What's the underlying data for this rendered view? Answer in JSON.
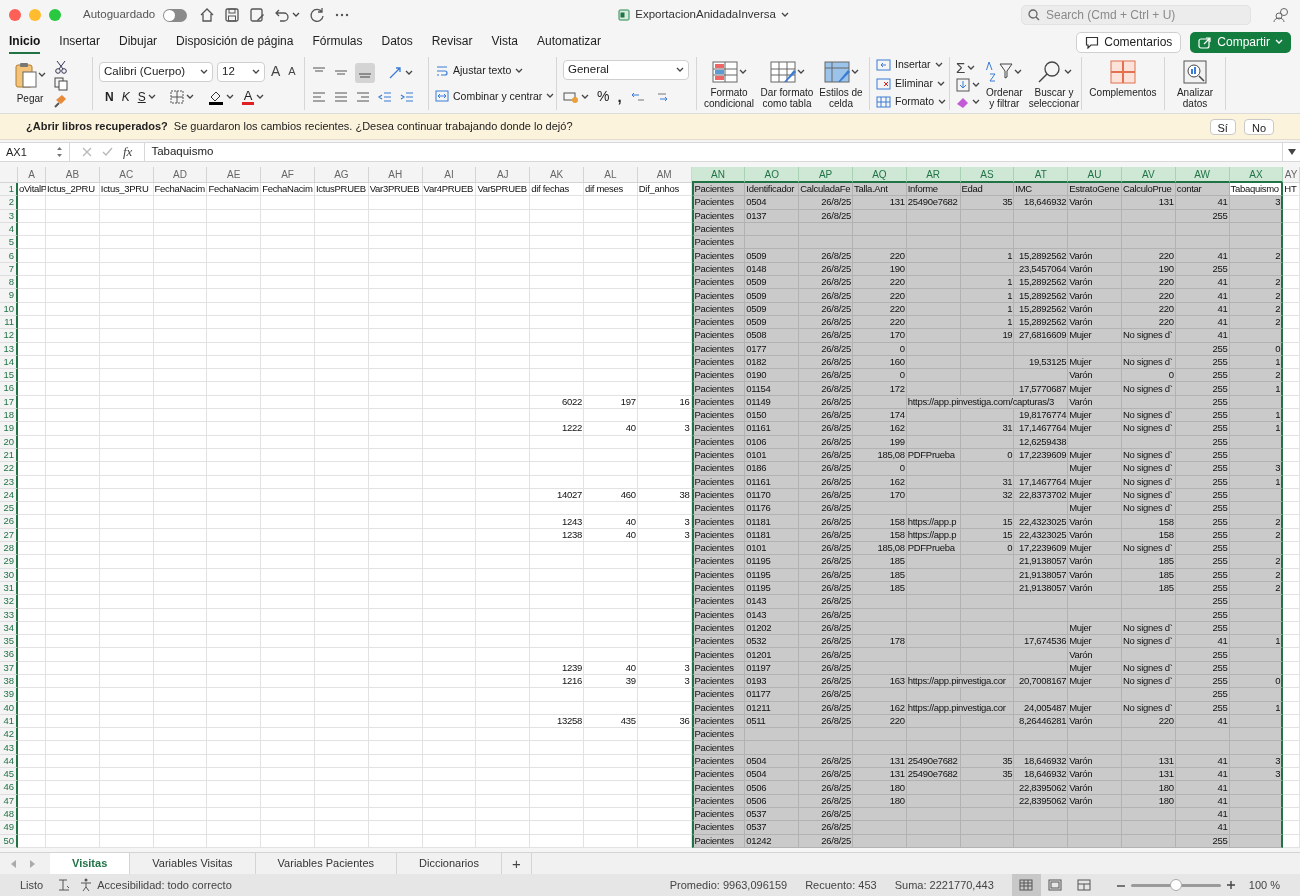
{
  "window": {
    "title": "ExportacionAnidadaInversa",
    "autosave_label": "Autoguardado",
    "autosave_on": false,
    "search_placeholder": "Search (Cmd + Ctrl + U)"
  },
  "menu_tabs": [
    {
      "label": "Inicio",
      "selected": true
    },
    {
      "label": "Insertar",
      "selected": false
    },
    {
      "label": "Dibujar",
      "selected": false
    },
    {
      "label": "Disposición de página",
      "selected": false
    },
    {
      "label": "Fórmulas",
      "selected": false
    },
    {
      "label": "Datos",
      "selected": false
    },
    {
      "label": "Revisar",
      "selected": false
    },
    {
      "label": "Vista",
      "selected": false
    },
    {
      "label": "Automatizar",
      "selected": false
    }
  ],
  "actions": {
    "comments": "Comentarios",
    "share": "Compartir"
  },
  "ribbon": {
    "paste": "Pegar",
    "font": "Calibri (Cuerpo)",
    "size": "12",
    "grow": "A",
    "shrink": "A",
    "bold": "N",
    "italic": "K",
    "underline": "S",
    "font_color": "A",
    "wrap": "Ajustar texto",
    "merge": "Combinar y centrar",
    "number_format": "General",
    "percent": "%",
    "comma": ",",
    "styles": [
      {
        "kind": "conditional",
        "label": "Formato condicional"
      },
      {
        "kind": "table",
        "label": "Dar formato como tabla"
      },
      {
        "kind": "cellstyle",
        "label": "Estilos de celda"
      }
    ],
    "cells": [
      {
        "kind": "insert",
        "label": "Insertar"
      },
      {
        "kind": "delete",
        "label": "Eliminar"
      },
      {
        "kind": "format",
        "label": "Formato"
      }
    ],
    "sum": "Σ",
    "editing": [
      {
        "kind": "sort",
        "label": "Ordenar y filtrar"
      },
      {
        "kind": "find",
        "label": "Buscar y seleccionar"
      },
      {
        "kind": "addins",
        "label": "Complementos"
      },
      {
        "kind": "analyze",
        "label": "Analizar datos"
      }
    ]
  },
  "message_bar": {
    "title": "¿Abrir libros recuperados?",
    "text": "Se guardaron los cambios recientes. ¿Desea continuar trabajando donde lo dejó?",
    "buttons": [
      "Sí",
      "No"
    ]
  },
  "formula_bar": {
    "name_box": "AX1",
    "fx": "fx",
    "formula": "Tabaquismo"
  },
  "grid": {
    "columns": [
      {
        "letter": "A",
        "selected": false
      },
      {
        "letter": "AB",
        "selected": false
      },
      {
        "letter": "AC",
        "selected": false
      },
      {
        "letter": "AD",
        "selected": false
      },
      {
        "letter": "AE",
        "selected": false
      },
      {
        "letter": "AF",
        "selected": false
      },
      {
        "letter": "AG",
        "selected": false
      },
      {
        "letter": "AH",
        "selected": false
      },
      {
        "letter": "AI",
        "selected": false
      },
      {
        "letter": "AJ",
        "selected": false
      },
      {
        "letter": "AK",
        "selected": false
      },
      {
        "letter": "AL",
        "selected": false
      },
      {
        "letter": "AM",
        "selected": false
      },
      {
        "letter": "AN",
        "selected": true
      },
      {
        "letter": "AO",
        "selected": true
      },
      {
        "letter": "AP",
        "selected": true
      },
      {
        "letter": "AQ",
        "selected": true
      },
      {
        "letter": "AR",
        "selected": true
      },
      {
        "letter": "AS",
        "selected": true
      },
      {
        "letter": "AT",
        "selected": true
      },
      {
        "letter": "AU",
        "selected": true
      },
      {
        "letter": "AV",
        "selected": true
      },
      {
        "letter": "AW",
        "selected": true
      },
      {
        "letter": "AX",
        "selected": true
      },
      {
        "letter": "AY",
        "selected": false
      }
    ],
    "rows": [
      {
        "number": "1",
        "selected": true,
        "cells": {
          "A": "oVitalP",
          "AB": "Ictus_2PRU",
          "AC": "Ictus_3PRU",
          "AD": "FechaNacim",
          "AE": "FechaNacim",
          "AF": "FechaNacim",
          "AG": "IctusPRUEB",
          "AH": "Var3PRUEB",
          "AI": "Var4PRUEB",
          "AJ": "Var5PRUEB",
          "AK": "dif fechas",
          "AL": "dif meses",
          "AM": "Dif_anhos",
          "AN": "Pacientes",
          "AO": "Identificador",
          "AP": "CalculadaFe",
          "AQ": "Talla.Ant",
          "AR": "Informe",
          "AS": "Edad",
          "AT": "IMC",
          "AU": "EstratoGene",
          "AV": "CalculoPrue",
          "AW": "contar",
          "AX": {
            "text": "Tabaquismo",
            "active": true
          },
          "AY": "HT"
        }
      },
      {
        "number": "2",
        "selected": true,
        "cells": {
          "AN": "Pacientes",
          "AO": "0504",
          "AP": "26/8/25",
          "AQ": "131",
          "AR": "25490e7682",
          "AS": "35",
          "AT": "18,646932",
          "AU": "Varón",
          "AV": "131",
          "AW": "41",
          "AX": "3"
        }
      },
      {
        "number": "3",
        "selected": true,
        "cells": {
          "AN": "Pacientes",
          "AO": "0137",
          "AP": "26/8/25",
          "AW": "255"
        }
      },
      {
        "number": "4",
        "selected": true,
        "cells": {
          "AN": "Pacientes"
        }
      },
      {
        "number": "5",
        "selected": true,
        "cells": {
          "AN": "Pacientes"
        }
      },
      {
        "number": "6",
        "selected": true,
        "cells": {
          "AN": "Pacientes",
          "AO": "0509",
          "AP": "26/8/25",
          "AQ": "220",
          "AS": "1",
          "AT": "15,2892562",
          "AU": "Varón",
          "AV": "220",
          "AW": "41",
          "AX": "2"
        }
      },
      {
        "number": "7",
        "selected": true,
        "cells": {
          "AN": "Pacientes",
          "AO": "0148",
          "AP": "26/8/25",
          "AQ": "190",
          "AT": "23,5457064",
          "AU": "Varón",
          "AV": "190",
          "AW": "255"
        }
      },
      {
        "number": "8",
        "selected": true,
        "cells": {
          "AN": "Pacientes",
          "AO": "0509",
          "AP": "26/8/25",
          "AQ": "220",
          "AS": "1",
          "AT": "15,2892562",
          "AU": "Varón",
          "AV": "220",
          "AW": "41",
          "AX": "2"
        }
      },
      {
        "number": "9",
        "selected": true,
        "cells": {
          "AN": "Pacientes",
          "AO": "0509",
          "AP": "26/8/25",
          "AQ": "220",
          "AS": "1",
          "AT": "15,2892562",
          "AU": "Varón",
          "AV": "220",
          "AW": "41",
          "AX": "2"
        }
      },
      {
        "number": "10",
        "selected": true,
        "cells": {
          "AN": "Pacientes",
          "AO": "0509",
          "AP": "26/8/25",
          "AQ": "220",
          "AS": "1",
          "AT": "15,2892562",
          "AU": "Varón",
          "AV": "220",
          "AW": "41",
          "AX": "2"
        }
      },
      {
        "number": "11",
        "selected": true,
        "cells": {
          "AN": "Pacientes",
          "AO": "0509",
          "AP": "26/8/25",
          "AQ": "220",
          "AS": "1",
          "AT": "15,2892562",
          "AU": "Varón",
          "AV": "220",
          "AW": "41",
          "AX": "2"
        }
      },
      {
        "number": "12",
        "selected": true,
        "cells": {
          "AN": "Pacientes",
          "AO": "0508",
          "AP": "26/8/25",
          "AQ": "170",
          "AS": "19",
          "AT": "27,6816609",
          "AU": "Mujer",
          "AV": "No signes d`",
          "AW": "41"
        }
      },
      {
        "number": "13",
        "selected": true,
        "cells": {
          "AN": "Pacientes",
          "AO": "0177",
          "AP": "26/8/25",
          "AQ": "0",
          "AW": "255",
          "AX": "0"
        }
      },
      {
        "number": "14",
        "selected": true,
        "cells": {
          "AN": "Pacientes",
          "AO": "0182",
          "AP": "26/8/25",
          "AQ": "160",
          "AT": "19,53125",
          "AU": "Mujer",
          "AV": "No signes d`",
          "AW": "255",
          "AX": "1"
        }
      },
      {
        "number": "15",
        "selected": true,
        "cells": {
          "AN": "Pacientes",
          "AO": "0190",
          "AP": "26/8/25",
          "AQ": "0",
          "AU": "Varón",
          "AV": "0",
          "AW": "255",
          "AX": "2"
        }
      },
      {
        "number": "16",
        "selected": true,
        "cells": {
          "AN": "Pacientes",
          "AO": "01154",
          "AP": "26/8/25",
          "AQ": "172",
          "AT": "17,5770687",
          "AU": "Mujer",
          "AV": "No signes d`",
          "AW": "255",
          "AX": "1"
        }
      },
      {
        "number": "17",
        "selected": true,
        "cells": {
          "AK": "6022",
          "AL": "197",
          "AM": "16",
          "AN": "Pacientes",
          "AO": "01149",
          "AP": "26/8/25",
          "AR": "https://app.pinvestiga.com/capturas/3",
          "AU": "Varón",
          "AW": "255"
        }
      },
      {
        "number": "18",
        "selected": true,
        "cells": {
          "AN": "Pacientes",
          "AO": "0150",
          "AP": "26/8/25",
          "AQ": "174",
          "AT": "19,8176774",
          "AU": "Mujer",
          "AV": "No signes d`",
          "AW": "255",
          "AX": "1"
        }
      },
      {
        "number": "19",
        "selected": true,
        "cells": {
          "AK": "1222",
          "AL": "40",
          "AM": "3",
          "AN": "Pacientes",
          "AO": "01161",
          "AP": "26/8/25",
          "AQ": "162",
          "AS": "31",
          "AT": "17,1467764",
          "AU": "Mujer",
          "AV": "No signes d`",
          "AW": "255",
          "AX": "1"
        }
      },
      {
        "number": "20",
        "selected": true,
        "cells": {
          "AN": "Pacientes",
          "AO": "0106",
          "AP": "26/8/25",
          "AQ": "199",
          "AT": "12,6259438",
          "AW": "255"
        }
      },
      {
        "number": "21",
        "selected": true,
        "cells": {
          "AN": "Pacientes",
          "AO": "0101",
          "AP": "26/8/25",
          "AQ": "185,08",
          "AR": "PDFPrueba",
          "AS": "0",
          "AT": "17,2239609",
          "AU": "Mujer",
          "AV": "No signes d`",
          "AW": "255"
        }
      },
      {
        "number": "22",
        "selected": true,
        "cells": {
          "AN": "Pacientes",
          "AO": "0186",
          "AP": "26/8/25",
          "AQ": "0",
          "AU": "Mujer",
          "AV": "No signes d`",
          "AW": "255",
          "AX": "3"
        }
      },
      {
        "number": "23",
        "selected": true,
        "cells": {
          "AN": "Pacientes",
          "AO": "01161",
          "AP": "26/8/25",
          "AQ": "162",
          "AS": "31",
          "AT": "17,1467764",
          "AU": "Mujer",
          "AV": "No signes d`",
          "AW": "255",
          "AX": "1"
        }
      },
      {
        "number": "24",
        "selected": true,
        "cells": {
          "AK": "14027",
          "AL": "460",
          "AM": "38",
          "AN": "Pacientes",
          "AO": "01170",
          "AP": "26/8/25",
          "AQ": "170",
          "AS": "32",
          "AT": "22,8373702",
          "AU": "Mujer",
          "AV": "No signes d`",
          "AW": "255"
        }
      },
      {
        "number": "25",
        "selected": true,
        "cells": {
          "AN": "Pacientes",
          "AO": "01176",
          "AP": "26/8/25",
          "AU": "Mujer",
          "AV": "No signes d`",
          "AW": "255"
        }
      },
      {
        "number": "26",
        "selected": true,
        "cells": {
          "AK": "1243",
          "AL": "40",
          "AM": "3",
          "AN": "Pacientes",
          "AO": "01181",
          "AP": "26/8/25",
          "AQ": "158",
          "AR": "https://app.p",
          "AS": "15",
          "AT": "22,4323025",
          "AU": "Varón",
          "AV": "158",
          "AW": "255",
          "AX": "2"
        }
      },
      {
        "number": "27",
        "selected": true,
        "cells": {
          "AK": "1238",
          "AL": "40",
          "AM": "3",
          "AN": "Pacientes",
          "AO": "01181",
          "AP": "26/8/25",
          "AQ": "158",
          "AR": "https://app.p",
          "AS": "15",
          "AT": "22,4323025",
          "AU": "Varón",
          "AV": "158",
          "AW": "255",
          "AX": "2"
        }
      },
      {
        "number": "28",
        "selected": true,
        "cells": {
          "AN": "Pacientes",
          "AO": "0101",
          "AP": "26/8/25",
          "AQ": "185,08",
          "AR": "PDFPrueba",
          "AS": "0",
          "AT": "17,2239609",
          "AU": "Mujer",
          "AV": "No signes d`",
          "AW": "255"
        }
      },
      {
        "number": "29",
        "selected": true,
        "cells": {
          "AN": "Pacientes",
          "AO": "01195",
          "AP": "26/8/25",
          "AQ": "185",
          "AT": "21,9138057",
          "AU": "Varón",
          "AV": "185",
          "AW": "255",
          "AX": "2"
        }
      },
      {
        "number": "30",
        "selected": true,
        "cells": {
          "AN": "Pacientes",
          "AO": "01195",
          "AP": "26/8/25",
          "AQ": "185",
          "AT": "21,9138057",
          "AU": "Varón",
          "AV": "185",
          "AW": "255",
          "AX": "2"
        }
      },
      {
        "number": "31",
        "selected": true,
        "cells": {
          "AN": "Pacientes",
          "AO": "01195",
          "AP": "26/8/25",
          "AQ": "185",
          "AT": "21,9138057",
          "AU": "Varón",
          "AV": "185",
          "AW": "255",
          "AX": "2"
        }
      },
      {
        "number": "32",
        "selected": true,
        "cells": {
          "AN": "Pacientes",
          "AO": "0143",
          "AP": "26/8/25",
          "AW": "255"
        }
      },
      {
        "number": "33",
        "selected": true,
        "cells": {
          "AN": "Pacientes",
          "AO": "0143",
          "AP": "26/8/25",
          "AW": "255"
        }
      },
      {
        "number": "34",
        "selected": true,
        "cells": {
          "AN": "Pacientes",
          "AO": "01202",
          "AP": "26/8/25",
          "AU": "Mujer",
          "AV": "No signes d`",
          "AW": "255"
        }
      },
      {
        "number": "35",
        "selected": true,
        "cells": {
          "AN": "Pacientes",
          "AO": "0532",
          "AP": "26/8/25",
          "AQ": "178",
          "AT": "17,674536",
          "AU": "Mujer",
          "AV": "No signes d`",
          "AW": "41",
          "AX": "1"
        }
      },
      {
        "number": "36",
        "selected": true,
        "cells": {
          "AN": "Pacientes",
          "AO": "01201",
          "AP": "26/8/25",
          "AU": "Varón",
          "AW": "255"
        }
      },
      {
        "number": "37",
        "selected": true,
        "cells": {
          "AK": "1239",
          "AL": "40",
          "AM": "3",
          "AN": "Pacientes",
          "AO": "01197",
          "AP": "26/8/25",
          "AU": "Mujer",
          "AV": "No signes d`",
          "AW": "255"
        }
      },
      {
        "number": "38",
        "selected": true,
        "cells": {
          "AK": "1216",
          "AL": "39",
          "AM": "3",
          "AN": "Pacientes",
          "AO": "0193",
          "AP": "26/8/25",
          "AQ": "163",
          "AR": "https://app.pinvestiga.cor",
          "AT": "20,7008167",
          "AU": "Mujer",
          "AV": "No signes d`",
          "AW": "255",
          "AX": "0"
        }
      },
      {
        "number": "39",
        "selected": true,
        "cells": {
          "AN": "Pacientes",
          "AO": "01177",
          "AP": "26/8/25",
          "AW": "255"
        }
      },
      {
        "number": "40",
        "selected": true,
        "cells": {
          "AN": "Pacientes",
          "AO": "01211",
          "AP": "26/8/25",
          "AQ": "162",
          "AR": "https://app.pinvestiga.cor",
          "AT": "24,005487",
          "AU": "Mujer",
          "AV": "No signes d`",
          "AW": "255",
          "AX": "1"
        }
      },
      {
        "number": "41",
        "selected": true,
        "cells": {
          "AK": "13258",
          "AL": "435",
          "AM": "36",
          "AN": "Pacientes",
          "AO": "0511",
          "AP": "26/8/25",
          "AQ": "220",
          "AT": "8,26446281",
          "AU": "Varón",
          "AV": "220",
          "AW": "41"
        }
      },
      {
        "number": "42",
        "selected": true,
        "cells": {
          "AN": "Pacientes"
        }
      },
      {
        "number": "43",
        "selected": true,
        "cells": {
          "AN": "Pacientes"
        }
      },
      {
        "number": "44",
        "selected": true,
        "cells": {
          "AN": "Pacientes",
          "AO": "0504",
          "AP": "26/8/25",
          "AQ": "131",
          "AR": "25490e7682",
          "AS": "35",
          "AT": "18,646932",
          "AU": "Varón",
          "AV": "131",
          "AW": "41",
          "AX": "3"
        }
      },
      {
        "number": "45",
        "selected": true,
        "cells": {
          "AN": "Pacientes",
          "AO": "0504",
          "AP": "26/8/25",
          "AQ": "131",
          "AR": "25490e7682",
          "AS": "35",
          "AT": "18,646932",
          "AU": "Varón",
          "AV": "131",
          "AW": "41",
          "AX": "3"
        }
      },
      {
        "number": "46",
        "selected": true,
        "cells": {
          "AN": "Pacientes",
          "AO": "0506",
          "AP": "26/8/25",
          "AQ": "180",
          "AT": "22,8395062",
          "AU": "Varón",
          "AV": "180",
          "AW": "41"
        }
      },
      {
        "number": "47",
        "selected": true,
        "cells": {
          "AN": "Pacientes",
          "AO": "0506",
          "AP": "26/8/25",
          "AQ": "180",
          "AT": "22,8395062",
          "AU": "Varón",
          "AV": "180",
          "AW": "41"
        }
      },
      {
        "number": "48",
        "selected": true,
        "cells": {
          "AN": "Pacientes",
          "AO": "0537",
          "AP": "26/8/25",
          "AW": "41"
        }
      },
      {
        "number": "49",
        "selected": true,
        "cells": {
          "AN": "Pacientes",
          "AO": "0537",
          "AP": "26/8/25",
          "AW": "41"
        }
      },
      {
        "number": "50",
        "selected": true,
        "cells": {
          "AN": "Pacientes",
          "AO": "01242",
          "AP": "26/8/25",
          "AW": "255"
        }
      }
    ]
  },
  "sheet_tabs": [
    {
      "label": "Visitas",
      "selected": true
    },
    {
      "label": "Variables Visitas",
      "selected": false
    },
    {
      "label": "Variables Pacientes",
      "selected": false
    },
    {
      "label": "Diccionarios",
      "selected": false
    }
  ],
  "add_sheet": "+",
  "status_bar": {
    "ready": "Listo",
    "accessibility": "Accesibilidad: todo correcto",
    "average": "Promedio: 9963,096159",
    "count": "Recuento: 453",
    "sum": "Suma: 2221770,443",
    "views": [
      {
        "kind": "normal",
        "selected": true
      },
      {
        "kind": "layout",
        "selected": false
      },
      {
        "kind": "pagebreak",
        "selected": false
      }
    ],
    "zoom": {
      "level": 0.5,
      "label": "100 %"
    }
  }
}
